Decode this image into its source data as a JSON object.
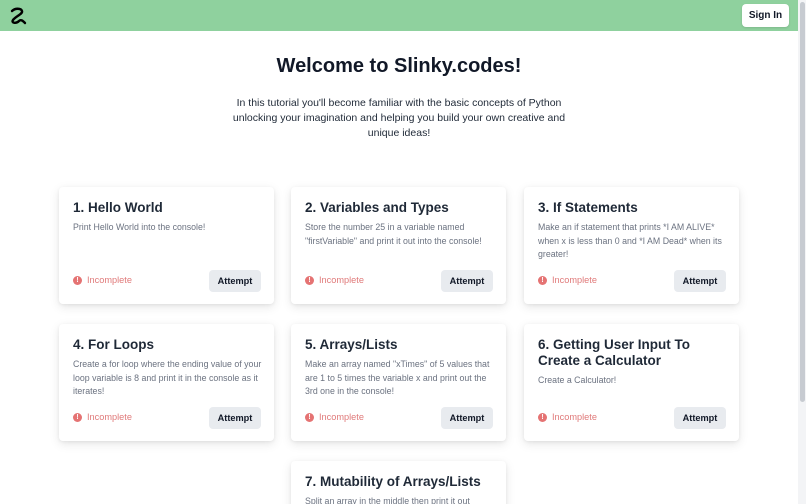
{
  "nav": {
    "signin_label": "Sign In",
    "logo_icon": "slinky-logo-icon",
    "bg_color": "#8fd19e"
  },
  "hero": {
    "title": "Welcome to Slinky.codes!",
    "intro": "In this tutorial you'll become familiar with the basic concepts of Python unlocking your imagination and helping you build your own creative and unique ideas!"
  },
  "lessons": [
    {
      "title": "1. Hello World",
      "description": "Print Hello World into the console!",
      "status": "Incomplete",
      "button": "Attempt"
    },
    {
      "title": "2. Variables and Types",
      "description": "Store the number 25 in a variable named \"firstVariable\" and print it out into the console!",
      "status": "Incomplete",
      "button": "Attempt"
    },
    {
      "title": "3. If Statements",
      "description": "Make an if statement that prints *I AM ALIVE* when x is less than 0 and *I AM Dead* when its greater!",
      "status": "Incomplete",
      "button": "Attempt"
    },
    {
      "title": "4. For Loops",
      "description": "Create a for loop where the ending value of your loop variable is 8 and print it in the console as it iterates!",
      "status": "Incomplete",
      "button": "Attempt"
    },
    {
      "title": "5. Arrays/Lists",
      "description": "Make an array named \"xTimes\" of 5 values that are 1 to 5 times the variable x and print out the 3rd one in the console!",
      "status": "Incomplete",
      "button": "Attempt"
    },
    {
      "title": "6. Getting User Input To Create a Calculator",
      "description": "Create a Calculator!",
      "status": "Incomplete",
      "button": "Attempt"
    },
    {
      "title": "7. Mutability of Arrays/Lists",
      "description": "Split an array in the middle then print it out",
      "status": "",
      "button": ""
    }
  ]
}
